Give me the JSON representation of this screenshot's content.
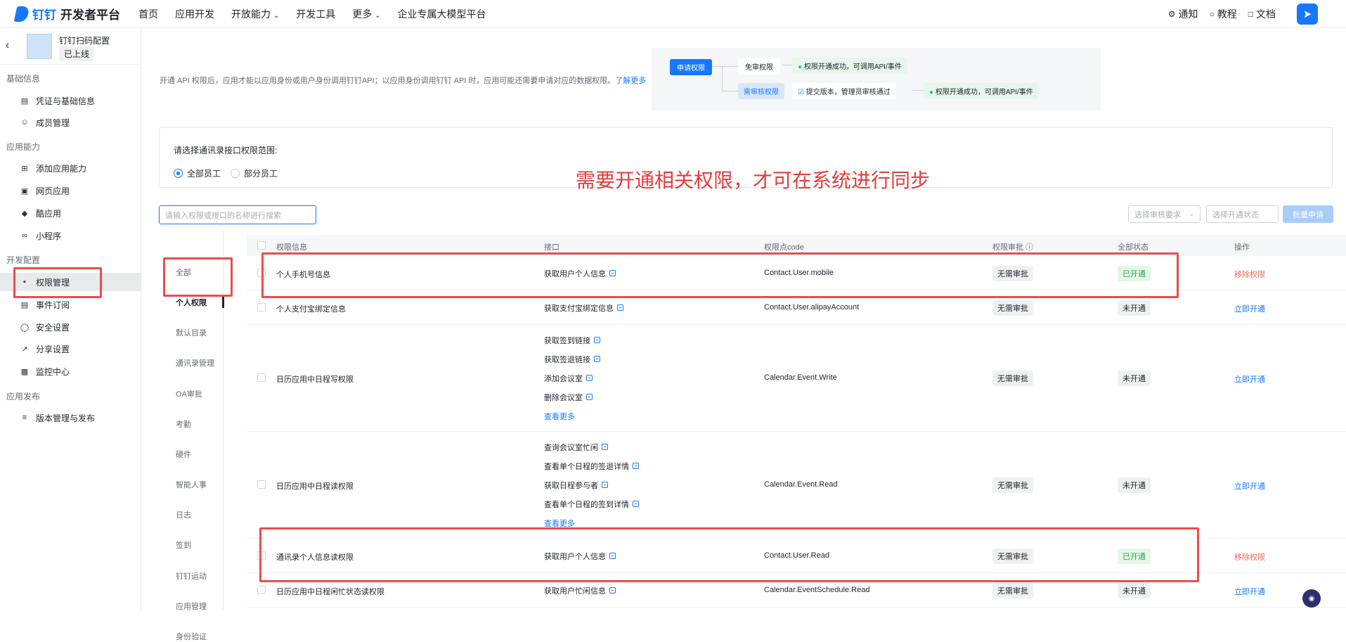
{
  "topbar": {
    "brand": "钉钉",
    "platform": "开发者平台",
    "nav": [
      "首页",
      "应用开发",
      "开放能力",
      "开发工具",
      "更多",
      "企业专属大模型平台"
    ],
    "right": [
      {
        "icon": "bell-icon",
        "label": "通知"
      },
      {
        "icon": "lightbulb-icon",
        "label": "教程"
      },
      {
        "icon": "book-icon",
        "label": "文档"
      }
    ]
  },
  "app": {
    "name": "钉钉扫码配置",
    "status": "已上线"
  },
  "sidebar": {
    "groups": [
      {
        "title": "基础信息",
        "items": [
          {
            "icon": "certificate-icon",
            "label": "凭证与基础信息"
          },
          {
            "icon": "user-icon",
            "label": "成员管理"
          }
        ]
      },
      {
        "title": "应用能力",
        "items": [
          {
            "icon": "grid-plus-icon",
            "label": "添加应用能力"
          },
          {
            "icon": "web-icon",
            "label": "网页应用"
          },
          {
            "icon": "cube-icon",
            "label": "酷应用"
          },
          {
            "icon": "link-icon",
            "label": "小程序"
          }
        ]
      },
      {
        "title": "开发配置",
        "items": [
          {
            "icon": "lock-icon",
            "label": "权限管理"
          },
          {
            "icon": "subscribe-icon",
            "label": "事件订阅"
          },
          {
            "icon": "shield-icon",
            "label": "安全设置"
          },
          {
            "icon": "share-icon",
            "label": "分享设置"
          },
          {
            "icon": "monitor-icon",
            "label": "监控中心"
          }
        ]
      },
      {
        "title": "应用发布",
        "items": [
          {
            "icon": "layers-icon",
            "label": "版本管理与发布"
          }
        ]
      }
    ]
  },
  "intro": {
    "text": "开通 API 权限后，应用才能以应用身份或用户身份调用钉钉API；以应用身份调用钉钉 API 时，应用可能还需要申请对应的数据权限。",
    "link": "了解更多"
  },
  "flow": {
    "apply": "申请权限",
    "free": "免审权限",
    "free_result": "权限开通成功，可调用API/事件",
    "review": "需审核权限",
    "review_step": "提交版本，管理员审核通过",
    "review_result": "权限开通成功，可调用API/事件"
  },
  "scope": {
    "question": "请选择通讯录接口权限范围:",
    "options": [
      "全部员工",
      "部分员工"
    ]
  },
  "notice": "需要开通相关权限，才可在系统进行同步",
  "filters": {
    "search_placeholder": "请输入权限或接口的名称进行搜索",
    "review_select": "选择审核要求",
    "status_select": "选择开通状态",
    "batch": "批量申请"
  },
  "categories": [
    "全部",
    "个人权限",
    "默认目录",
    "通讯录管理",
    "OA审批",
    "考勤",
    "硬件",
    "智能人事",
    "日志",
    "签到",
    "钉钉运动",
    "应用管理",
    "身份验证"
  ],
  "table": {
    "headers": [
      "权限信息",
      "接口",
      "权限点code",
      "权限审批",
      "全部状态",
      "操作"
    ],
    "rows": [
      {
        "name": "个人手机号信息",
        "apis": [
          "获取用户个人信息"
        ],
        "more": "",
        "code": "Contact.User.mobile",
        "approval": "无需审批",
        "status": "已开通",
        "action": "移除权限"
      },
      {
        "name": "个人支付宝绑定信息",
        "apis": [
          "获取支付宝绑定信息"
        ],
        "more": "",
        "code": "Contact.User.alipayAccount",
        "approval": "无需审批",
        "status": "未开通",
        "action": "立即开通"
      },
      {
        "name": "日历应用中日程写权限",
        "apis": [
          "获取签到链接",
          "获取签退链接",
          "添加会议室",
          "删除会议室"
        ],
        "more": "查看更多",
        "code": "Calendar.Event.Write",
        "approval": "无需审批",
        "status": "未开通",
        "action": "立即开通"
      },
      {
        "name": "日历应用中日程读权限",
        "apis": [
          "查询会议室忙闲",
          "查看单个日程的签退详情",
          "获取日程参与者",
          "查看单个日程的签到详情"
        ],
        "more": "查看更多",
        "code": "Calendar.Event.Read",
        "approval": "无需审批",
        "status": "未开通",
        "action": "立即开通"
      },
      {
        "name": "通讯录个人信息读权限",
        "apis": [
          "获取用户个人信息"
        ],
        "more": "",
        "code": "Contact.User.Read",
        "approval": "无需审批",
        "status": "已开通",
        "action": "移除权限"
      },
      {
        "name": "日历应用中日程闲忙状态读权限",
        "apis": [
          "获取用户忙闲信息"
        ],
        "more": "",
        "code": "Calendar.EventSchedule.Read",
        "approval": "无需审批",
        "status": "未开通",
        "action": "立即开通"
      }
    ]
  },
  "colors": {
    "accent": "#1677ff",
    "highlight": "#eb4d4d",
    "enabled": "#2ea84a",
    "remove": "#f06a4f"
  }
}
